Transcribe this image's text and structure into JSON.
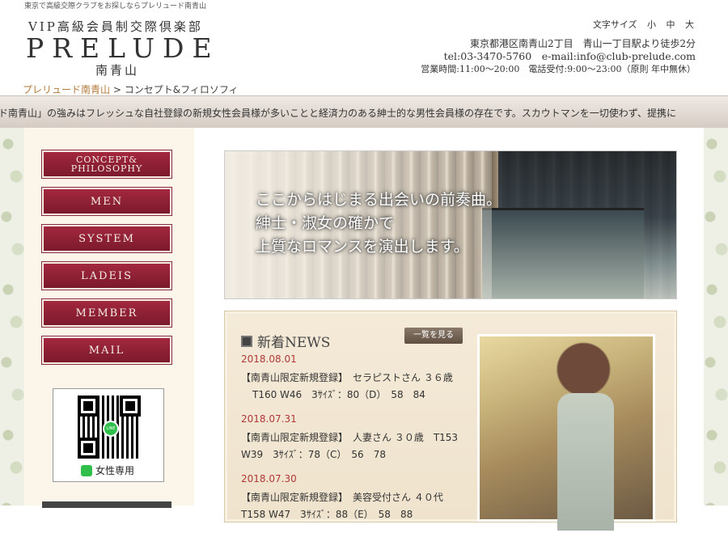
{
  "header": {
    "tagline": "東京で高級交際クラブをお探しならプレリュード南青山",
    "logo_line1": "VIP高級会員制交際倶楽部",
    "logo_word": "PRELUDE",
    "logo_sub": "南青山",
    "font_size": {
      "label": "文字サイズ",
      "small": "小",
      "medium": "中",
      "large": "大"
    },
    "address": "東京都港区南青山2丁目　青山一丁目駅より徒歩2分",
    "tel_email": "tel:03-3470-5760　e-mail:info@club-prelude.com",
    "hours": "営業時間:11:00～20:00　電話受付:9:00～23:00（原則 年中無休）"
  },
  "breadcrumb": {
    "home": "プレリュード南青山",
    "separator": ">",
    "current": "コンセプト&フィロソフィ"
  },
  "ticker": "ード南青山」の強みはフレッシュな自社登録の新規女性会員様が多いことと経済力のある紳士的な男性会員様の存在です。スカウトマンを一切使わず、提携に",
  "nav": {
    "concept_line1": "CONCEPT&",
    "concept_line2": "PHILOSOPHY",
    "men": "MEN",
    "system": "SYSTEM",
    "ladeis": "LADEIS",
    "member": "MEMBER",
    "mail": "MAIL"
  },
  "qr": {
    "caption": "女性専用",
    "badge": "LINE"
  },
  "hero": {
    "line1": "ここからはじまる出会いの前奏曲。",
    "line2": "紳士・淑女の確かで",
    "line3": "上質なロマンスを演出します。"
  },
  "news": {
    "title": "新着NEWS",
    "list_button": "一覧を見る",
    "items": [
      {
        "date": "2018.08.01",
        "text1": "【南青山限定新規登録】　セラピストさん ３６歳",
        "text2": "T160 W46　3ｻｲｽﾞ：80（D）　58　84"
      },
      {
        "date": "2018.07.31",
        "text1": "【南青山限定新規登録】　人妻さん ３０歳　T153",
        "text2": "W39　3ｻｲｽﾞ：78（C）　56　78"
      },
      {
        "date": "2018.07.30",
        "text1": "【南青山限定新規登録】　美容受付さん ４０代",
        "text2": "T158 W47　3ｻｲｽﾞ：88（E）　58　88"
      }
    ]
  },
  "colors": {
    "nav_button": "#8f2135",
    "news_date": "#b03838",
    "breadcrumb_home": "#b47a3a"
  }
}
